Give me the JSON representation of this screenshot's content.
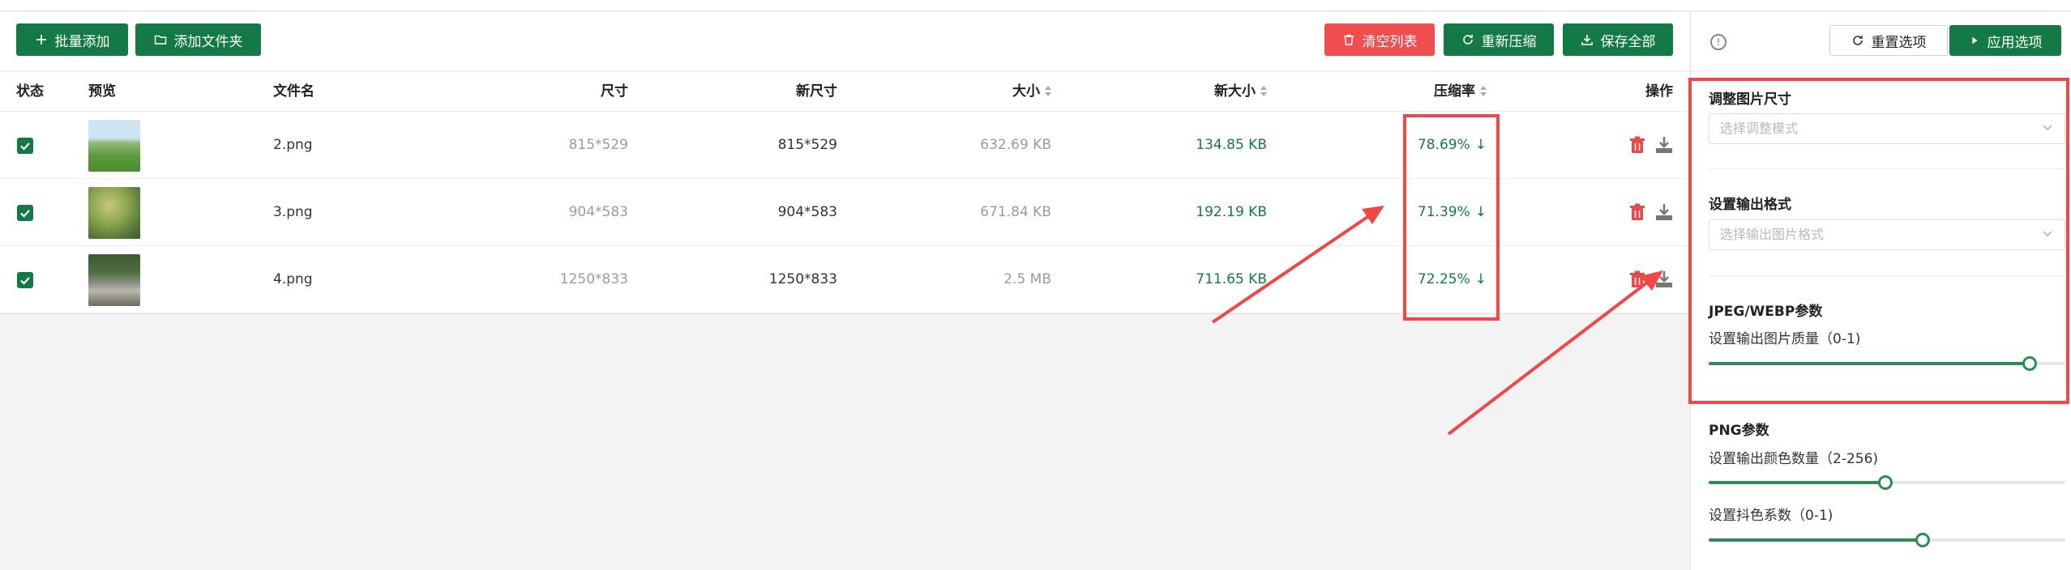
{
  "toolbar": {
    "batch_add": "批量添加",
    "add_folder": "添加文件夹",
    "clear_list": "清空列表",
    "recompress": "重新压缩",
    "save_all": "保存全部"
  },
  "table": {
    "headers": {
      "status": "状态",
      "preview": "预览",
      "filename": "文件名",
      "size": "尺寸",
      "new_size": "新尺寸",
      "filesize": "大小",
      "new_filesize": "新大小",
      "ratio": "压缩率",
      "actions": "操作"
    },
    "rows": [
      {
        "checked": true,
        "filename": "2.png",
        "dimensions": "815*529",
        "new_dimensions": "815*529",
        "size": "632.69 KB",
        "new_size": "134.85 KB",
        "ratio": "78.69%",
        "thumb": "meadow"
      },
      {
        "checked": true,
        "filename": "3.png",
        "dimensions": "904*583",
        "new_dimensions": "904*583",
        "size": "671.84 KB",
        "new_size": "192.19 KB",
        "ratio": "71.39%",
        "thumb": "flowers"
      },
      {
        "checked": true,
        "filename": "4.png",
        "dimensions": "1250*833",
        "new_dimensions": "1250*833",
        "size": "2.5 MB",
        "new_size": "711.65 KB",
        "ratio": "72.25%",
        "thumb": "stream"
      }
    ]
  },
  "panel": {
    "reset": "重置选项",
    "apply": "应用选项",
    "resize_title": "调整图片尺寸",
    "resize_placeholder": "选择调整模式",
    "format_title": "设置输出格式",
    "format_placeholder": "选择输出图片格式",
    "jpeg_title": "JPEG/WEBP参数",
    "quality_label": "设置输出图片质量（0-1)",
    "quality_value": 0.9,
    "png_title": "PNG参数",
    "colors_label": "设置输出颜色数量（2-256)",
    "colors_value": 128,
    "dither_label": "设置抖色系数（0-1)",
    "dither_value": 0.6
  },
  "colors": {
    "primary": "#137a45",
    "danger": "#f04d4f",
    "highlight": "#ee4848"
  },
  "icons": [
    "plus-icon",
    "folder-icon",
    "trash-icon",
    "refresh-icon",
    "download-icon",
    "info-icon",
    "play-icon",
    "chevron-down-icon",
    "arrow-down-icon"
  ]
}
